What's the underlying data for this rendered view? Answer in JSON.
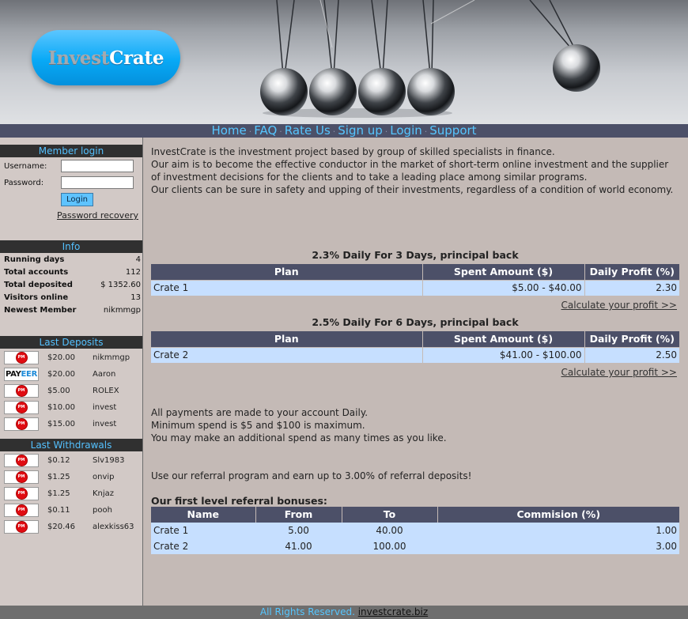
{
  "brand": {
    "part1": "Invest",
    "part2": "Crate"
  },
  "nav": [
    "Home",
    "FAQ",
    "Rate Us",
    "Sign up",
    "Login",
    "Support"
  ],
  "nav_sep": "·",
  "member_login": {
    "title": "Member login",
    "username_label": "Username:",
    "password_label": "Password:",
    "username_value": "",
    "password_value": "",
    "login_button": "Login",
    "recovery_link": "Password recovery"
  },
  "info": {
    "title": "Info",
    "rows": [
      {
        "label": "Running days",
        "value": "4"
      },
      {
        "label": "Total accounts",
        "value": "112"
      },
      {
        "label": "Total deposited",
        "value": "$ 1352.60"
      },
      {
        "label": "Visitors online",
        "value": "13"
      },
      {
        "label": "Newest Member",
        "value": "nikmmgp"
      }
    ]
  },
  "last_deposits": {
    "title": "Last Deposits",
    "rows": [
      {
        "method": "pm-icon",
        "amount": "$20.00",
        "user": "nikmmgp"
      },
      {
        "method": "payeer-icon",
        "amount": "$20.00",
        "user": "Aaron"
      },
      {
        "method": "pm-icon",
        "amount": "$5.00",
        "user": "ROLEX"
      },
      {
        "method": "pm-icon",
        "amount": "$10.00",
        "user": "invest"
      },
      {
        "method": "pm-icon",
        "amount": "$15.00",
        "user": "invest"
      }
    ]
  },
  "last_withdrawals": {
    "title": "Last Withdrawals",
    "rows": [
      {
        "method": "pm-icon",
        "amount": "$0.12",
        "user": "Slv1983"
      },
      {
        "method": "pm-icon",
        "amount": "$1.25",
        "user": "onvip"
      },
      {
        "method": "pm-icon",
        "amount": "$1.25",
        "user": "Knjaz"
      },
      {
        "method": "pm-icon",
        "amount": "$0.11",
        "user": "pooh"
      },
      {
        "method": "pm-icon",
        "amount": "$20.46",
        "user": "alexkiss63"
      }
    ]
  },
  "icons": {
    "pm_text": "PM",
    "payeer_a": "PAY",
    "payeer_b": "EER"
  },
  "intro": {
    "line1": "InvestCrate is the investment project based by group of skilled specialists in finance.",
    "line2": "Our aim is to become the effective conductor in the market of short-term online investment and the supplier of investment decisions for the clients and to take a leading place among similar programs.",
    "line3": "Our clients can be sure in safety and upping of their investments, regardless of a condition of world economy."
  },
  "plans": [
    {
      "title": "2.3% Daily For 3 Days, principal back",
      "headers": [
        "Plan",
        "Spent Amount ($)",
        "Daily Profit (%)"
      ],
      "row": [
        "Crate 1",
        "$5.00 - $40.00",
        "2.30"
      ],
      "calc_link": "Calculate your profit >>"
    },
    {
      "title": "2.5% Daily For 6 Days, principal back",
      "headers": [
        "Plan",
        "Spent Amount ($)",
        "Daily Profit (%)"
      ],
      "row": [
        "Crate 2",
        "$41.00 - $100.00",
        "2.50"
      ],
      "calc_link": "Calculate your profit >>"
    }
  ],
  "payment_info": {
    "line1": "All payments are made to your account Daily.",
    "line2": "Minimum spend is $5 and $100 is maximum.",
    "line3": "You may make an additional spend as many times as you like."
  },
  "referral": {
    "text": "Use our referral program and earn up to 3.00% of referral deposits!",
    "title": "Our first level referral bonuses:",
    "headers": [
      "Name",
      "From",
      "To",
      "Commision (%)"
    ],
    "rows": [
      [
        "Crate 1",
        "5.00",
        "40.00",
        "1.00"
      ],
      [
        "Crate 2",
        "41.00",
        "100.00",
        "3.00"
      ]
    ]
  },
  "footer": {
    "rights": "All Rights Reserved.",
    "link": "investcrate.biz"
  },
  "colors": {
    "nav_bg": "#4c5068",
    "nav_text": "#56c6ff",
    "sidebar_bg": "#d2c9c6",
    "main_bg": "#c4bab6",
    "table_cell": "#c6dfff",
    "logo_blue": "#08a9f6"
  }
}
